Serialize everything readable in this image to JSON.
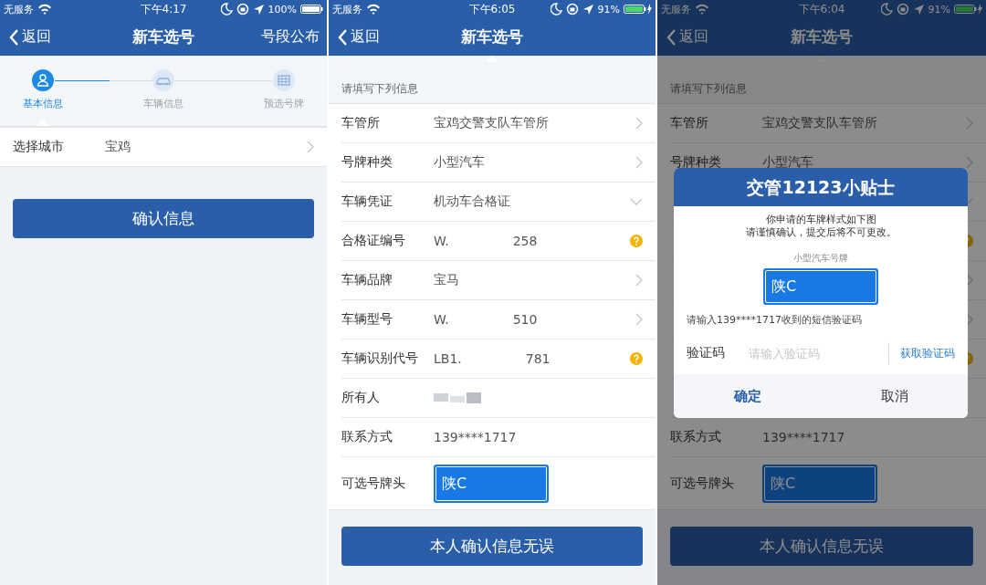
{
  "screens": [
    {
      "status_bar": {
        "carrier": "无服务",
        "time": "下午4:17",
        "battery": "100%",
        "charging": false
      },
      "nav": {
        "back": "返回",
        "title": "新车选号",
        "action": "号段公布"
      },
      "dimmed": false,
      "steps": [
        {
          "label": "基本信息",
          "selected": true
        },
        {
          "label": "车辆信息",
          "selected": false
        },
        {
          "label": "预选号牌",
          "selected": false
        }
      ],
      "rows": [
        {
          "kind": "select",
          "label": "选择城市",
          "value": "宝鸡"
        }
      ],
      "confirm_button": "确认信息"
    },
    {
      "status_bar": {
        "carrier": "无服务",
        "time": "下午6:05",
        "battery": "91%",
        "charging": true
      },
      "nav": {
        "back": "返回",
        "title": "新车选号"
      },
      "dimmed": false,
      "section_header": "请填写下列信息",
      "rows": [
        {
          "kind": "select",
          "label": "车管所",
          "value": "宝鸡交警支队车管所"
        },
        {
          "kind": "select",
          "label": "号牌种类",
          "value": "小型汽车"
        },
        {
          "kind": "dropdown",
          "label": "车辆凭证",
          "value": "机动车合格证"
        },
        {
          "kind": "help",
          "label": "合格证编号",
          "value": "W.",
          "value_tail": "258"
        },
        {
          "kind": "select",
          "label": "车辆品牌",
          "value": "宝马"
        },
        {
          "kind": "select",
          "label": "车辆型号",
          "value": "W.",
          "value_tail": "510"
        },
        {
          "kind": "help",
          "label": "车辆识别代号",
          "value": "LB1.",
          "value_tail": "781"
        },
        {
          "kind": "plain",
          "label": "所有人",
          "redacted": true
        },
        {
          "kind": "plain",
          "label": "联系方式",
          "value": "139****1717"
        },
        {
          "kind": "plate",
          "label": "可选号牌头",
          "value": "陕C"
        }
      ],
      "confirm_button": "本人确认信息无误"
    },
    {
      "status_bar": {
        "carrier": "无服务",
        "time": "下午6:04",
        "battery": "91%",
        "charging": true
      },
      "nav": {
        "back": "返回",
        "title": "新车选号"
      },
      "dimmed": true,
      "section_header": "请填写下列信息",
      "rows": [
        {
          "kind": "select",
          "label": "车管所",
          "value": "宝鸡交警支队车管所"
        },
        {
          "kind": "select",
          "label": "号牌种类",
          "value": "小型汽车"
        },
        {
          "kind": "dropdown"
        },
        {
          "kind": "help"
        },
        {
          "kind": "select"
        },
        {
          "kind": "select"
        },
        {
          "kind": "help"
        },
        {
          "kind": "plain"
        },
        {
          "kind": "plain",
          "label": "联系方式",
          "value": "139****1717"
        },
        {
          "kind": "plate",
          "label": "可选号牌头",
          "value": "陕C"
        }
      ],
      "confirm_button": "本人确认信息无误",
      "dialog": {
        "title": "交管12123小贴士",
        "message": [
          "你申请的车牌样式如下图",
          "请谨慎确认，提交后将不可更改。"
        ],
        "plate_caption": "小型汽车号牌",
        "plate": "陕C",
        "sms_hint": "请输入139****1717收到的短信验证码",
        "code_label": "验证码",
        "code_placeholder": "请输入验证码",
        "get_code": "获取验证码",
        "ok": "确定",
        "cancel": "取消"
      }
    }
  ]
}
